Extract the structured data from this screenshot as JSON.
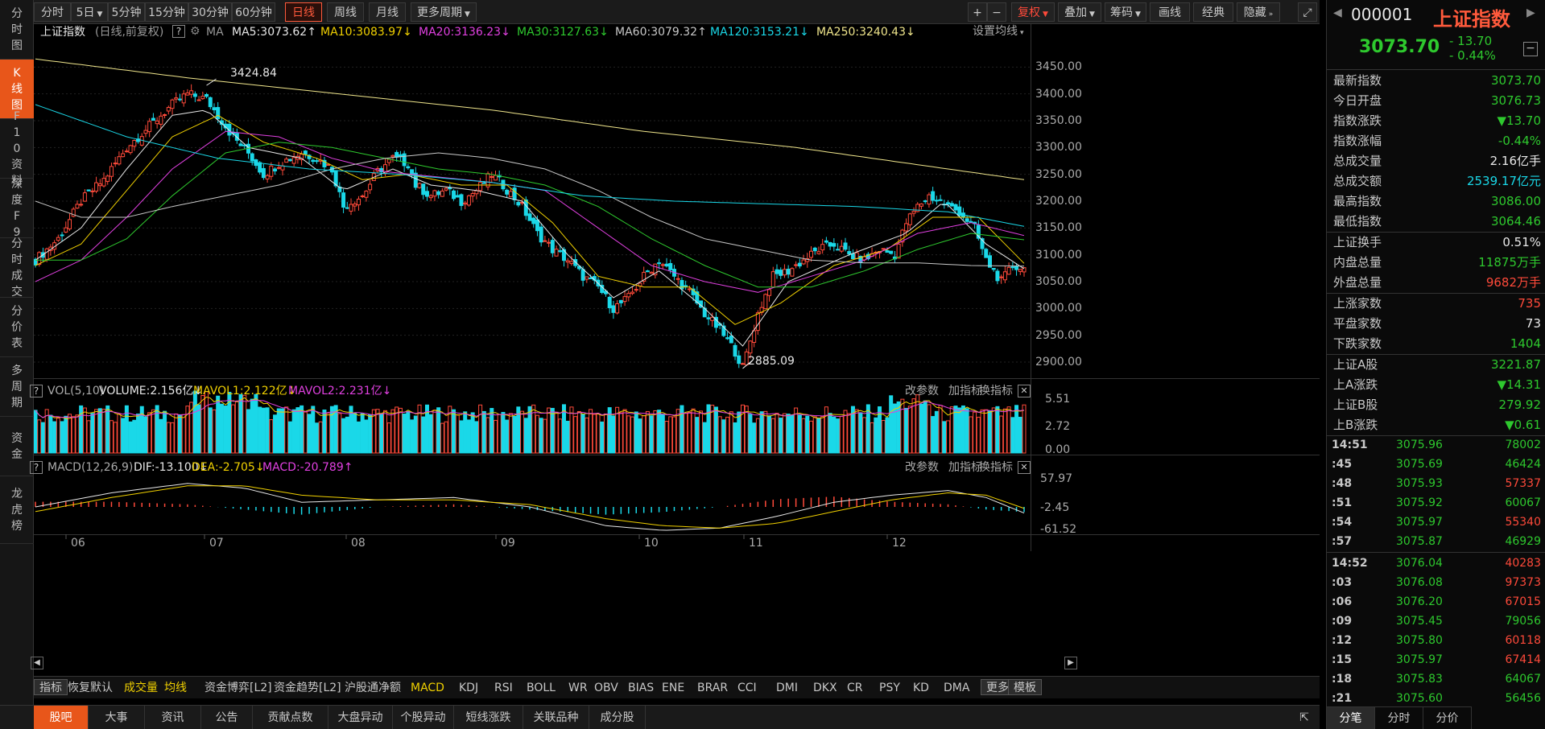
{
  "leftnav": [
    {
      "label": "分时图",
      "active": false
    },
    {
      "label": "K线图",
      "active": true
    },
    {
      "label": "F10资料",
      "active": false
    },
    {
      "label": "深度F9",
      "active": false
    },
    {
      "label": "分时成交",
      "active": false
    },
    {
      "label": "分价表",
      "active": false
    },
    {
      "label": "多周期",
      "active": false
    },
    {
      "label": "资金",
      "active": false
    },
    {
      "label": "龙虎榜",
      "active": false
    }
  ],
  "toolbar": {
    "periods": [
      "分时",
      "5日",
      "5分钟",
      "15分钟",
      "30分钟",
      "60分钟",
      "日线",
      "周线",
      "月线",
      "更多周期"
    ],
    "active_period": "日线",
    "right": {
      "plus": "+",
      "minus": "−",
      "fuquan": "复权",
      "overlay": "叠加",
      "chips": "筹码",
      "draw": "画线",
      "classic": "经典",
      "hide": "隐藏",
      "expand": "⤢"
    }
  },
  "main_chart": {
    "name": "上证指数",
    "mode": "(日线,前复权)",
    "ma_label": "MA",
    "ma": [
      {
        "label": "MA5:3073.62",
        "arrow": "↑",
        "color": "#e8e8e8"
      },
      {
        "label": "MA10:3083.97",
        "arrow": "↓",
        "color": "#f0d000"
      },
      {
        "label": "MA20:3136.23",
        "arrow": "↓",
        "color": "#e040e0"
      },
      {
        "label": "MA30:3127.63",
        "arrow": "↓",
        "color": "#2ec92e"
      },
      {
        "label": "MA60:3079.32",
        "arrow": "↑",
        "color": "#c8c8c8"
      },
      {
        "label": "MA120:3153.21",
        "arrow": "↓",
        "color": "#1ad8e8"
      },
      {
        "label": "MA250:3240.43",
        "arrow": "↓",
        "color": "#f0e68c"
      }
    ],
    "settings": "设置均线",
    "high_label": "3424.84",
    "low_label": "2885.09",
    "y_ticks": [
      "3450.00",
      "3400.00",
      "3350.00",
      "3300.00",
      "3250.00",
      "3200.00",
      "3150.00",
      "3100.00",
      "3050.00",
      "3000.00",
      "2950.00",
      "2900.00"
    ]
  },
  "vol_panel": {
    "q": "?",
    "title": "VOL(5,10)",
    "volume": "VOLUME:2.156亿",
    "volume_arrow": "↓",
    "mavol1": "MAVOL1:2.122亿",
    "mavol1_arrow": "↓",
    "mavol2": "MAVOL2:2.231亿",
    "mavol2_arrow": "↓",
    "actions": [
      "改参数",
      "加指标",
      "换指标"
    ],
    "y_ticks": [
      "5.51",
      "2.72",
      "0.00"
    ]
  },
  "macd_panel": {
    "q": "?",
    "title": "MACD(12,26,9)",
    "dif": "DIF:-13.100",
    "dif_arrow": "↓",
    "dea": "DEA:-2.705",
    "dea_arrow": "↓",
    "macd": "MACD:-20.789",
    "macd_arrow": "↑",
    "actions": [
      "改参数",
      "加指标",
      "换指标"
    ],
    "y_ticks": [
      "57.97",
      "-2.45",
      "-61.52"
    ]
  },
  "x_ticks": [
    "06",
    "07",
    "08",
    "09",
    "10",
    "11",
    "12"
  ],
  "indicator_tabs": [
    "指标",
    "恢复默认",
    "成交量",
    "均线",
    "资金博弈[L2]",
    "资金趋势[L2]",
    "沪股通净额",
    "MACD",
    "KDJ",
    "RSI",
    "BOLL",
    "WR",
    "OBV",
    "BIAS",
    "ENE",
    "BRAR",
    "CCI",
    "DMI",
    "DKX",
    "CR",
    "PSY",
    "KD",
    "DMA",
    "更多",
    "模板"
  ],
  "bottom_tabs": [
    "股吧",
    "大事",
    "资讯",
    "公告",
    "贡献点数",
    "大盘异动",
    "个股异动",
    "短线涨跌",
    "关联品种",
    "成分股"
  ],
  "quote": {
    "code": "000001",
    "name": "上证指数",
    "price": "3073.70",
    "change": "- 13.70",
    "change_pct": "- 0.44%",
    "rows": [
      {
        "k": "最新指数",
        "v": "3073.70",
        "c": "g"
      },
      {
        "k": "今日开盘",
        "v": "3076.73",
        "c": "g"
      },
      {
        "k": "指数涨跌",
        "v": "▼13.70",
        "c": "g"
      },
      {
        "k": "指数涨幅",
        "v": "-0.44%",
        "c": "g"
      },
      {
        "k": "总成交量",
        "v": "2.16亿手",
        "c": "w"
      },
      {
        "k": "总成交额",
        "v": "2539.17亿元",
        "c": "c"
      },
      {
        "k": "最高指数",
        "v": "3086.00",
        "c": "g"
      },
      {
        "k": "最低指数",
        "v": "3064.46",
        "c": "g"
      },
      {
        "k": "上证换手",
        "v": "0.51%",
        "c": "w"
      },
      {
        "k": "内盘总量",
        "v": "11875万手",
        "c": "g"
      },
      {
        "k": "外盘总量",
        "v": "9682万手",
        "c": "r"
      },
      {
        "k": "上涨家数",
        "v": "735",
        "c": "r"
      },
      {
        "k": "平盘家数",
        "v": "73",
        "c": "w"
      },
      {
        "k": "下跌家数",
        "v": "1404",
        "c": "g"
      },
      {
        "k": "上证A股",
        "v": "3221.87",
        "c": "g"
      },
      {
        "k": "上A涨跌",
        "v": "▼14.31",
        "c": "g"
      },
      {
        "k": "上证B股",
        "v": "279.92",
        "c": "g"
      },
      {
        "k": "上B涨跌",
        "v": "▼0.61",
        "c": "g"
      }
    ],
    "ticks": [
      {
        "t": "14:51",
        "p": "3075.96",
        "q": "78002",
        "c": "g"
      },
      {
        "t": ":45",
        "p": "3075.69",
        "q": "46424",
        "c": "g"
      },
      {
        "t": ":48",
        "p": "3075.93",
        "q": "57337",
        "c": "r"
      },
      {
        "t": ":51",
        "p": "3075.92",
        "q": "60067",
        "c": "g"
      },
      {
        "t": ":54",
        "p": "3075.97",
        "q": "55340",
        "c": "r"
      },
      {
        "t": ":57",
        "p": "3075.87",
        "q": "46929",
        "c": "g"
      },
      {
        "t": "14:52",
        "p": "3076.04",
        "q": "40283",
        "c": "r"
      },
      {
        "t": ":03",
        "p": "3076.08",
        "q": "97373",
        "c": "r"
      },
      {
        "t": ":06",
        "p": "3076.20",
        "q": "67015",
        "c": "r"
      },
      {
        "t": ":09",
        "p": "3075.45",
        "q": "79056",
        "c": "g"
      },
      {
        "t": ":12",
        "p": "3075.80",
        "q": "60118",
        "c": "r"
      },
      {
        "t": ":15",
        "p": "3075.97",
        "q": "67414",
        "c": "r"
      },
      {
        "t": ":18",
        "p": "3075.83",
        "q": "64067",
        "c": "g"
      },
      {
        "t": ":21",
        "p": "3075.60",
        "q": "56456",
        "c": "g"
      }
    ],
    "tabs": [
      "分笔",
      "分时",
      "分价"
    ]
  },
  "chart_data": {
    "type": "candlestick",
    "title": "上证指数",
    "ylim": [
      2870,
      3470
    ],
    "x_months": [
      "06",
      "07",
      "08",
      "09",
      "10",
      "11",
      "12"
    ],
    "close_path": [
      [
        0,
        3090
      ],
      [
        6,
        3130
      ],
      [
        12,
        3200
      ],
      [
        18,
        3240
      ],
      [
        24,
        3300
      ],
      [
        30,
        3340
      ],
      [
        36,
        3380
      ],
      [
        40,
        3400
      ],
      [
        45,
        3390
      ],
      [
        48,
        3360
      ],
      [
        52,
        3320
      ],
      [
        56,
        3290
      ],
      [
        60,
        3250
      ],
      [
        64,
        3270
      ],
      [
        70,
        3290
      ],
      [
        74,
        3280
      ],
      [
        78,
        3260
      ],
      [
        81,
        3190
      ],
      [
        86,
        3210
      ],
      [
        90,
        3255
      ],
      [
        94,
        3280
      ],
      [
        98,
        3270
      ],
      [
        100,
        3230
      ],
      [
        104,
        3210
      ],
      [
        108,
        3220
      ],
      [
        112,
        3200
      ],
      [
        116,
        3220
      ],
      [
        120,
        3250
      ],
      [
        123,
        3230
      ],
      [
        128,
        3190
      ],
      [
        132,
        3140
      ],
      [
        136,
        3110
      ],
      [
        140,
        3090
      ],
      [
        144,
        3060
      ],
      [
        148,
        3040
      ],
      [
        152,
        3000
      ],
      [
        156,
        3020
      ],
      [
        160,
        3060
      ],
      [
        164,
        3090
      ],
      [
        168,
        3060
      ],
      [
        172,
        3030
      ],
      [
        176,
        2990
      ],
      [
        180,
        2960
      ],
      [
        184,
        2920
      ],
      [
        186,
        2890
      ],
      [
        190,
        2990
      ],
      [
        194,
        3060
      ],
      [
        198,
        3070
      ],
      [
        202,
        3090
      ],
      [
        206,
        3110
      ],
      [
        210,
        3120
      ],
      [
        214,
        3100
      ],
      [
        218,
        3090
      ],
      [
        222,
        3110
      ],
      [
        226,
        3100
      ],
      [
        229,
        3160
      ],
      [
        232,
        3190
      ],
      [
        235,
        3210
      ],
      [
        239,
        3195
      ],
      [
        243,
        3180
      ],
      [
        247,
        3150
      ],
      [
        250,
        3090
      ],
      [
        254,
        3050
      ],
      [
        257,
        3080
      ],
      [
        260,
        3074
      ]
    ],
    "high_point": [
      45,
      3424.84
    ],
    "low_point": [
      186,
      2885.09
    ],
    "ma": {
      "MA5": [
        [
          0,
          3090
        ],
        [
          12,
          3150
        ],
        [
          24,
          3260
        ],
        [
          36,
          3360
        ],
        [
          45,
          3370
        ],
        [
          56,
          3300
        ],
        [
          70,
          3280
        ],
        [
          81,
          3220
        ],
        [
          94,
          3260
        ],
        [
          104,
          3230
        ],
        [
          116,
          3220
        ],
        [
          128,
          3200
        ],
        [
          140,
          3100
        ],
        [
          152,
          3020
        ],
        [
          164,
          3070
        ],
        [
          176,
          3000
        ],
        [
          186,
          2930
        ],
        [
          198,
          3050
        ],
        [
          214,
          3100
        ],
        [
          229,
          3140
        ],
        [
          239,
          3200
        ],
        [
          250,
          3120
        ],
        [
          260,
          3074
        ]
      ],
      "MA10": [
        [
          0,
          3080
        ],
        [
          12,
          3120
        ],
        [
          24,
          3220
        ],
        [
          36,
          3320
        ],
        [
          48,
          3360
        ],
        [
          60,
          3310
        ],
        [
          74,
          3280
        ],
        [
          86,
          3240
        ],
        [
          98,
          3250
        ],
        [
          112,
          3230
        ],
        [
          124,
          3230
        ],
        [
          136,
          3160
        ],
        [
          148,
          3060
        ],
        [
          160,
          3040
        ],
        [
          172,
          3040
        ],
        [
          184,
          2970
        ],
        [
          196,
          3010
        ],
        [
          210,
          3080
        ],
        [
          224,
          3110
        ],
        [
          236,
          3170
        ],
        [
          248,
          3170
        ],
        [
          260,
          3084
        ]
      ],
      "MA20": [
        [
          0,
          3050
        ],
        [
          12,
          3090
        ],
        [
          24,
          3170
        ],
        [
          36,
          3260
        ],
        [
          50,
          3330
        ],
        [
          64,
          3320
        ],
        [
          78,
          3280
        ],
        [
          92,
          3255
        ],
        [
          106,
          3245
        ],
        [
          120,
          3235
        ],
        [
          134,
          3220
        ],
        [
          148,
          3150
        ],
        [
          162,
          3080
        ],
        [
          176,
          3050
        ],
        [
          190,
          3030
        ],
        [
          204,
          3060
        ],
        [
          218,
          3090
        ],
        [
          232,
          3140
        ],
        [
          246,
          3160
        ],
        [
          260,
          3136
        ]
      ],
      "MA30": [
        [
          0,
          3090
        ],
        [
          12,
          3090
        ],
        [
          24,
          3130
        ],
        [
          36,
          3210
        ],
        [
          50,
          3290
        ],
        [
          64,
          3310
        ],
        [
          78,
          3300
        ],
        [
          92,
          3280
        ],
        [
          106,
          3260
        ],
        [
          120,
          3250
        ],
        [
          134,
          3230
        ],
        [
          148,
          3190
        ],
        [
          162,
          3130
        ],
        [
          176,
          3080
        ],
        [
          190,
          3040
        ],
        [
          204,
          3040
        ],
        [
          218,
          3070
        ],
        [
          232,
          3110
        ],
        [
          246,
          3140
        ],
        [
          260,
          3128
        ]
      ],
      "MA60": [
        [
          0,
          3200
        ],
        [
          12,
          3170
        ],
        [
          24,
          3170
        ],
        [
          36,
          3190
        ],
        [
          50,
          3210
        ],
        [
          64,
          3230
        ],
        [
          78,
          3260
        ],
        [
          92,
          3280
        ],
        [
          106,
          3290
        ],
        [
          120,
          3280
        ],
        [
          134,
          3260
        ],
        [
          148,
          3220
        ],
        [
          162,
          3170
        ],
        [
          176,
          3130
        ],
        [
          190,
          3110
        ],
        [
          204,
          3090
        ],
        [
          218,
          3085
        ],
        [
          232,
          3085
        ],
        [
          246,
          3080
        ],
        [
          260,
          3079
        ]
      ],
      "MA120": [
        [
          0,
          3380
        ],
        [
          24,
          3320
        ],
        [
          48,
          3280
        ],
        [
          72,
          3260
        ],
        [
          96,
          3250
        ],
        [
          120,
          3235
        ],
        [
          144,
          3210
        ],
        [
          168,
          3200
        ],
        [
          192,
          3195
        ],
        [
          216,
          3190
        ],
        [
          240,
          3180
        ],
        [
          260,
          3153
        ]
      ],
      "MA250": [
        [
          0,
          3465
        ],
        [
          40,
          3430
        ],
        [
          80,
          3400
        ],
        [
          120,
          3370
        ],
        [
          160,
          3330
        ],
        [
          200,
          3300
        ],
        [
          240,
          3260
        ],
        [
          260,
          3240
        ]
      ]
    },
    "macd_dif": [
      [
        0,
        0
      ],
      [
        20,
        30
      ],
      [
        40,
        50
      ],
      [
        55,
        40
      ],
      [
        70,
        10
      ],
      [
        90,
        15
      ],
      [
        110,
        20
      ],
      [
        130,
        0
      ],
      [
        150,
        -40
      ],
      [
        165,
        -50
      ],
      [
        180,
        -45
      ],
      [
        195,
        -20
      ],
      [
        210,
        10
      ],
      [
        225,
        25
      ],
      [
        240,
        35
      ],
      [
        250,
        20
      ],
      [
        260,
        -13
      ]
    ],
    "macd_dea": [
      [
        0,
        -10
      ],
      [
        20,
        20
      ],
      [
        40,
        45
      ],
      [
        55,
        45
      ],
      [
        70,
        25
      ],
      [
        90,
        15
      ],
      [
        110,
        15
      ],
      [
        130,
        5
      ],
      [
        150,
        -25
      ],
      [
        165,
        -40
      ],
      [
        180,
        -45
      ],
      [
        195,
        -35
      ],
      [
        210,
        -10
      ],
      [
        225,
        15
      ],
      [
        240,
        30
      ],
      [
        250,
        25
      ],
      [
        260,
        -3
      ]
    ]
  }
}
